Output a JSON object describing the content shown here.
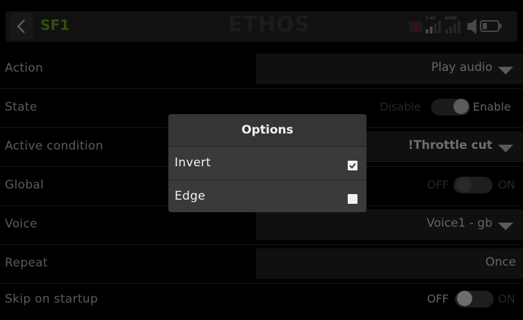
{
  "header": {
    "title": "SF1",
    "logo_text": "ETHOS",
    "signal_24": "2.4G",
    "signal_900": "900M",
    "back_icon": "chevron-left-icon",
    "colors": {
      "title": "#4d7a15",
      "logo": "#2d2d2d"
    }
  },
  "rows": {
    "action": {
      "label": "Action",
      "value": "Play audio"
    },
    "state": {
      "label": "State",
      "off": "Disable",
      "on": "Enable",
      "value": "on"
    },
    "active_condition": {
      "label": "Active condition",
      "value": "!Throttle cut"
    },
    "global": {
      "label": "Global",
      "off": "OFF",
      "on": "ON",
      "value": "off"
    },
    "voice": {
      "label": "Voice",
      "value": "Voice1 - gb"
    },
    "repeat": {
      "label": "Repeat",
      "value": "Once"
    },
    "skip": {
      "label": "Skip on startup",
      "off": "OFF",
      "on": "ON",
      "value": "off"
    }
  },
  "dialog": {
    "title": "Options",
    "options": [
      {
        "label": "Invert",
        "checked": true
      },
      {
        "label": "Edge",
        "checked": false
      }
    ]
  }
}
